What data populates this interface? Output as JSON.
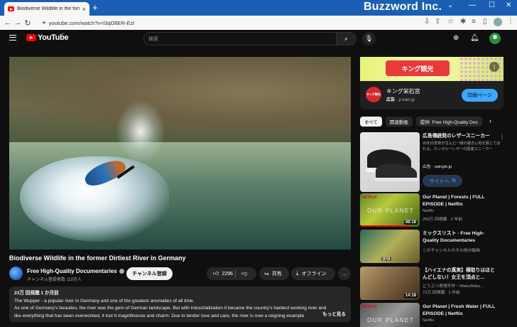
{
  "browser": {
    "tab_title": "Biodiverse Wildlife in the former",
    "tab_close": "×",
    "new_tab": "+",
    "brand": "Buzzword Inc.",
    "url": "youtube.com/watch?v=l3qO8ER-Ezl",
    "window_controls": [
      "⌄",
      "—",
      "☐",
      "✕"
    ]
  },
  "header": {
    "logo_text": "YouTube",
    "logo_region": "JP",
    "search_placeholder": "検索"
  },
  "video": {
    "title": "Biodiverse Wildlife in the former Dirtiest River in Germany",
    "channel_name": "Free High-Quality Documentaries",
    "subscribers": "チャンネル登録者数 110万人",
    "subscribe_label": "チャンネル登録",
    "likes": "2296",
    "share_label": "共有",
    "offline_label": "オフライン",
    "more_label": "…",
    "description": {
      "meta": "23万 回視聴  1 か月前",
      "lines": [
        "The Wupper - a popular river in Germany and one of the greatest anomalies of all time.",
        "As one of Germany's beauties, the river was the gem of German landscape. But with industrialization it became the country's hardest working river and",
        "like everything that has been overworked, it lost it magnificence and charm. Due to tender love and care, the river is now a reigning example"
      ],
      "more": "もっと見る"
    }
  },
  "sidebar": {
    "ad_banner_text": "キング観光",
    "ad_logo_text": "キング観光",
    "ad_name": "キング栄石宮",
    "ad_label": "広告",
    "ad_domain": "· p-kain.jp",
    "ad_button": "詳細ページ",
    "chips": [
      "すべて",
      "関連動画",
      "提供: Free High-Quality Doc"
    ],
    "chip_next": "›",
    "recommendations": [
      {
        "title": "広島傳統発のレザースニーカー",
        "channel": "90年の技術が生んだ一級の履き心地を展じて訪れる。カンガルーレザーの国産スニーカー",
        "meta": "広告 · spingle.jp",
        "button": "サイトへ",
        "type": "ad"
      },
      {
        "title": "Our Planet | Forests | FULL EPISODE | Netflix",
        "channel": "Netflix",
        "meta": "256万 回視聴 · 2 年前",
        "duration": "48:18",
        "badge": "NETFLIX",
        "thumb_text": "OUR PLANET",
        "watched": 0.85
      },
      {
        "title": "ミックスリスト - Free High-Quality Documentaries",
        "channel": "",
        "meta": "このチャンネルのその他の動画",
        "duration": "((•))"
      },
      {
        "title": "【ハイエナの真実】横取りはほとんどしない！女王を頂点と...",
        "channel": "どうぶつ奇想天外・WakuWaku...",
        "meta": "72万 回視聴 · 1 年前",
        "duration": "14:18"
      },
      {
        "title": "Our Planet | Fresh Water | FULL EPISODE | Netflix",
        "channel": "Netflix",
        "meta": "",
        "badge": "NETFLIX",
        "thumb_text": "OUR PLANET"
      }
    ]
  }
}
